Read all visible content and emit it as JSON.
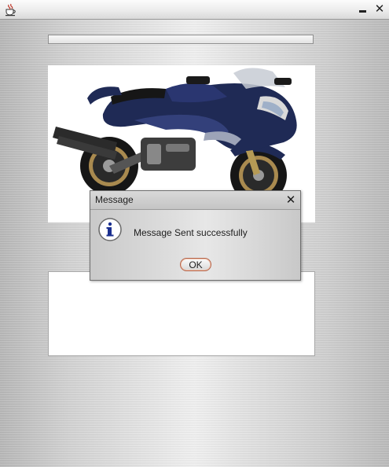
{
  "window": {
    "app_icon": "java-cup-icon",
    "controls": [
      "minimize-icon",
      "close-icon"
    ],
    "close_glyph": "✕"
  },
  "progress": {
    "value": 0
  },
  "image_panel": {
    "image": "motorcycle-photo"
  },
  "dialog": {
    "title": "Message",
    "close_glyph": "✕",
    "icon": "info-icon",
    "message": "Message Sent successfully",
    "ok_label": "OK"
  },
  "colors": {
    "motorcycle_body": "#1f2a55",
    "ok_border": "#b4644a",
    "info_letter": "#1b2f8f"
  }
}
